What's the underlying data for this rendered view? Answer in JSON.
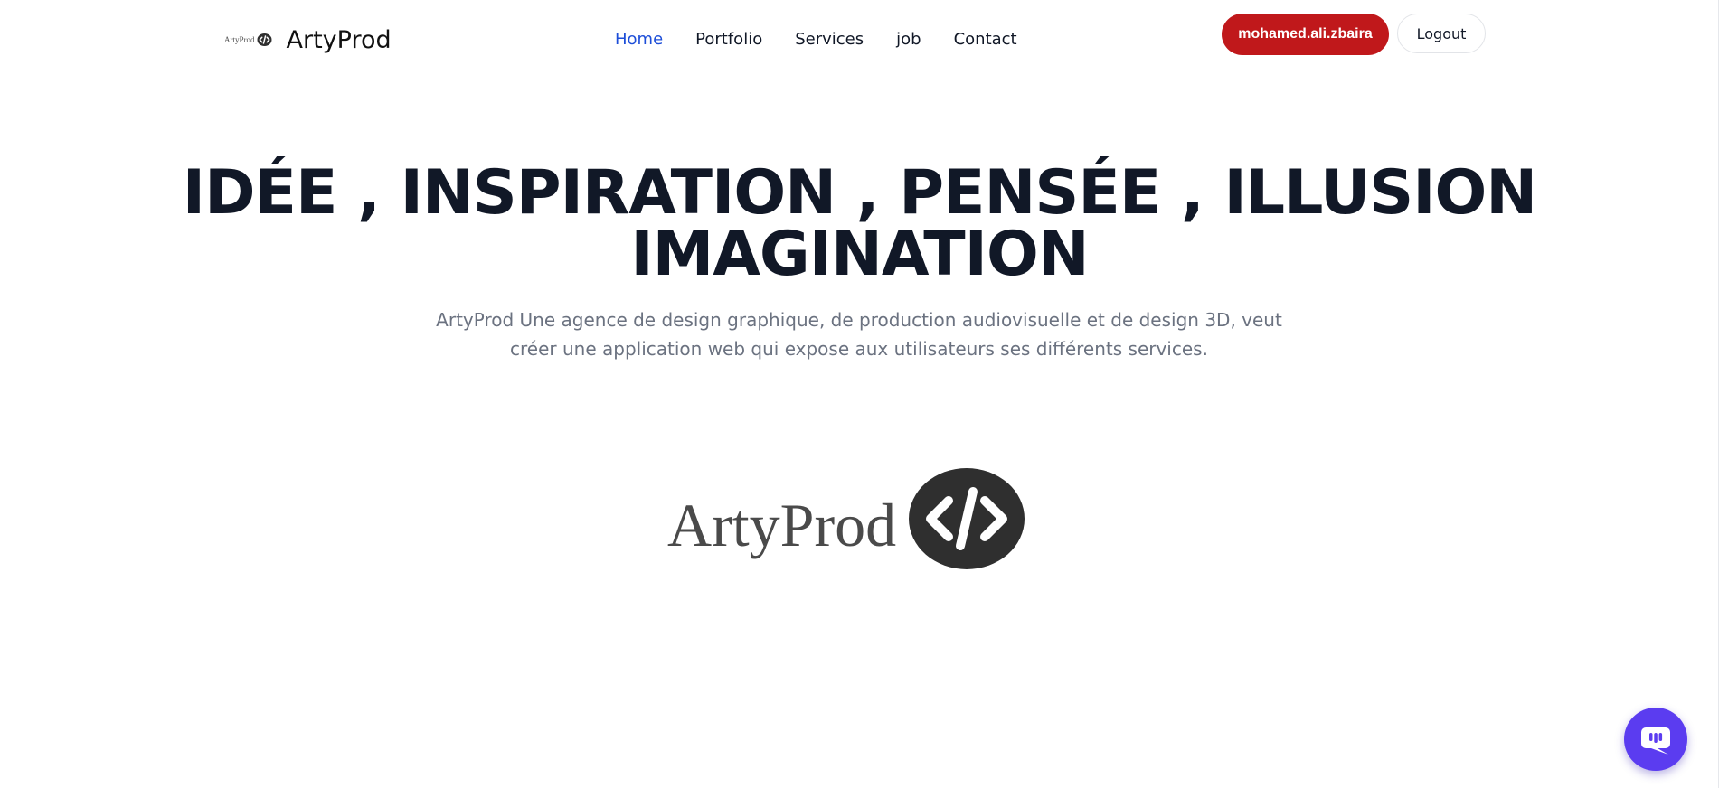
{
  "brand": {
    "mini_text": "ArtyProd",
    "name": "ArtyProd",
    "logo_icon": "code-brackets-icon"
  },
  "nav": {
    "items": [
      {
        "label": "Home",
        "active": true
      },
      {
        "label": "Portfolio",
        "active": false
      },
      {
        "label": "Services",
        "active": false
      },
      {
        "label": "job",
        "active": false
      },
      {
        "label": "Contact",
        "active": false
      }
    ]
  },
  "user": {
    "name": "mohamed.ali.zbaira",
    "logout_label": "Logout"
  },
  "hero": {
    "title_line1": "IDÉE , INSPIRATION , PENSÉE , ILLUSION",
    "title_line2": "IMAGINATION",
    "subtitle_line1": "ArtyProd Une agence de design graphique, de production audiovisuelle et de design 3D, veut",
    "subtitle_line2": "créer une application web qui expose aux utilisateurs ses différents services."
  },
  "hero_logo": {
    "text": "ArtyProd",
    "icon": "code-brackets-icon"
  },
  "chat": {
    "icon": "chat-bubble-icon"
  },
  "colors": {
    "accent_blue": "#1d4ed8",
    "user_button_red": "#c0181b",
    "heading_dark": "#111827",
    "subtitle_gray": "#6b7280",
    "chat_purple": "#5b3cf0",
    "logo_dark": "#2f2f2f"
  }
}
